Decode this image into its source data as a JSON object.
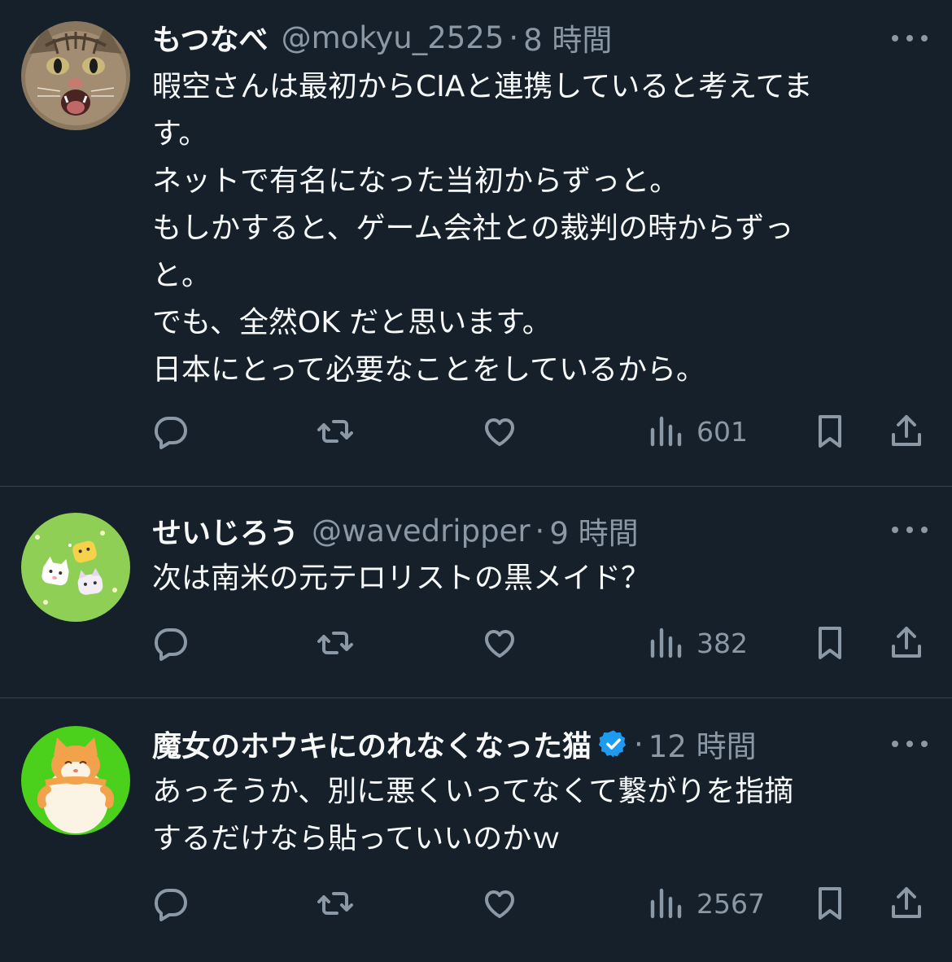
{
  "colors": {
    "background": "#15202b",
    "text_primary": "#f7f9f9",
    "text_secondary": "#8b98a5",
    "divider": "#38444d",
    "verified": "#1d9bf0"
  },
  "icons": {
    "reply": "reply-icon",
    "retweet": "retweet-icon",
    "like": "like-icon",
    "views": "views-icon",
    "bookmark": "bookmark-icon",
    "share": "share-icon",
    "more": "more-icon",
    "verified": "verified-badge-icon"
  },
  "tweets": [
    {
      "name": "もつなべ",
      "handle": "@mokyu_2525",
      "separator": "·",
      "time": "8 時間",
      "avatar": "cat-photo-avatar",
      "text_lines": [
        "暇空さんは最初からCIAと連携していると考えてま",
        "す。",
        "ネットで有名になった当初からずっと。",
        "もしかすると、ゲーム会社との裁判の時からずっ",
        "と。",
        "でも、全然OK だと思います。",
        "日本にとって必要なことをしているから。"
      ],
      "views": "601",
      "verified": false
    },
    {
      "name": "せいじろう",
      "handle": "@wavedripper",
      "separator": "·",
      "time": "9 時間",
      "avatar": "cartoon-cats-on-grass-avatar",
      "text_lines": [
        "次は南米の元テロリストの黒メイド？"
      ],
      "views": "382",
      "verified": false
    },
    {
      "name": "魔女のホウキにのれなくなった猫",
      "handle": "",
      "separator": "·",
      "time": "12 時間",
      "avatar": "cartoon-fat-cat-avatar",
      "text_lines": [
        "あっそうか、別に悪くいってなくて繋がりを指摘",
        "するだけなら貼っていいのかｗ"
      ],
      "views": "2567",
      "verified": true
    }
  ]
}
